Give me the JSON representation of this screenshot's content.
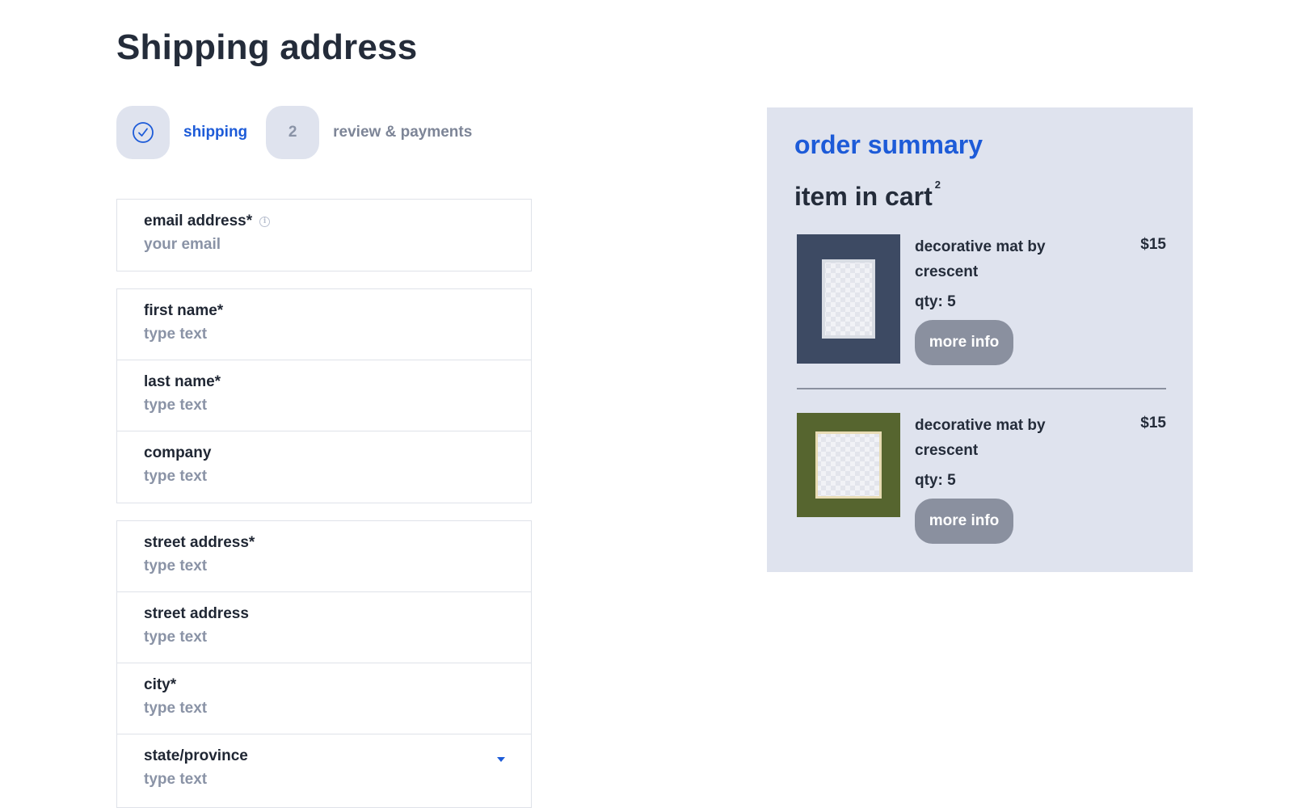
{
  "page": {
    "title": "Shipping address"
  },
  "stepper": {
    "steps": [
      {
        "badge": "",
        "label": "shipping",
        "state": "completed",
        "icon": "check-circle-icon"
      },
      {
        "badge": "2",
        "label": "review & payments",
        "state": "pending"
      }
    ]
  },
  "form": {
    "email": {
      "label": "email address*",
      "placeholder": "your email",
      "icon": "info-icon"
    },
    "first_name": {
      "label": "first name*",
      "placeholder": "type text"
    },
    "last_name": {
      "label": "last name*",
      "placeholder": "type text"
    },
    "company": {
      "label": "company",
      "placeholder": "type text"
    },
    "street1": {
      "label": "street address*",
      "placeholder": "type text"
    },
    "street2": {
      "label": "street address",
      "placeholder": "type text"
    },
    "city": {
      "label": "city*",
      "placeholder": "type text"
    },
    "state": {
      "label": "state/province",
      "placeholder": "type text",
      "icon": "caret-down-icon"
    }
  },
  "summary": {
    "title": "order summary",
    "cart_heading": "item in cart",
    "cart_count": "2",
    "items": [
      {
        "name": "decorative mat by crescent",
        "price": "$15",
        "qty": "qty: 5",
        "button": "more info",
        "mat_color": "#3d4a63",
        "inner_border": "#d9dde4"
      },
      {
        "name": "decorative mat by crescent",
        "price": "$15",
        "qty": "qty: 5",
        "button": "more info",
        "mat_color": "#56652f",
        "inner_border": "#e8dcb4"
      }
    ]
  },
  "colors": {
    "accent": "#1d5bd8",
    "panel": "#dfe3ee",
    "button": "#8a909f"
  }
}
